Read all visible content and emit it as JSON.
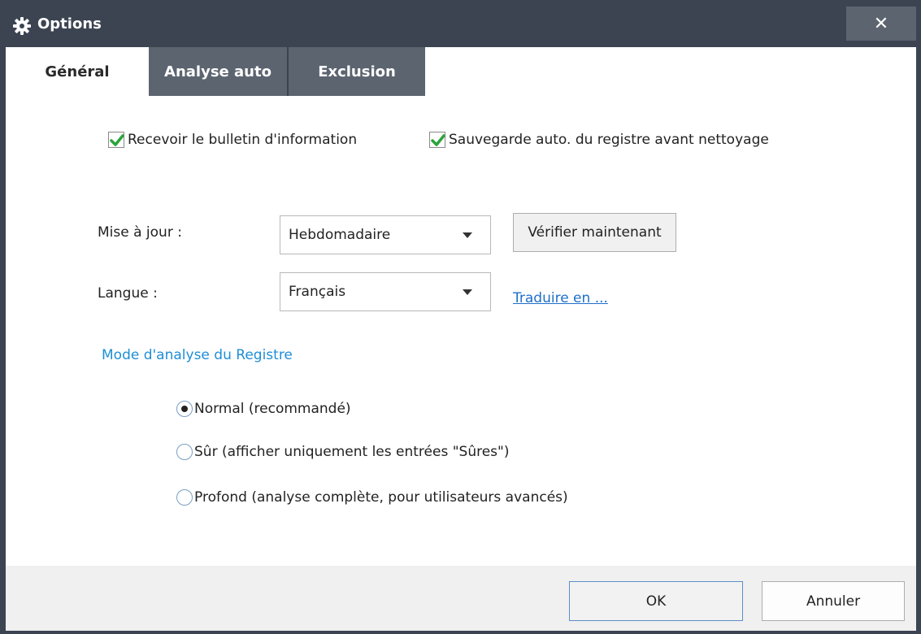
{
  "window": {
    "title": "Options",
    "close_label": "✕",
    "accent_color": "#3c4452",
    "link_color": "#1f6fc9",
    "section_color": "#1f8ed6"
  },
  "tabs": [
    {
      "label": "Général",
      "active": true
    },
    {
      "label": "Analyse auto",
      "active": false
    },
    {
      "label": "Exclusion",
      "active": false
    }
  ],
  "general": {
    "newsletter": {
      "label": "Recevoir le bulletin d'information",
      "checked": true
    },
    "auto_backup": {
      "label": "Sauvegarde auto. du registre avant nettoyage",
      "checked": true
    },
    "update": {
      "label": "Mise à jour :",
      "value": "Hebdomadaire",
      "check_now_label": "Vérifier maintenant"
    },
    "language": {
      "label": "Langue :",
      "value": "Français",
      "translate_link": "Traduire en ..."
    },
    "scan_mode": {
      "title": "Mode d'analyse du Registre",
      "options": [
        {
          "label": "Normal (recommandé)",
          "selected": true
        },
        {
          "label": "Sûr (afficher uniquement les entrées \"Sûres\")",
          "selected": false
        },
        {
          "label": "Profond (analyse complète, pour utilisateurs avancés)",
          "selected": false
        }
      ]
    }
  },
  "footer": {
    "ok_label": "OK",
    "cancel_label": "Annuler"
  }
}
